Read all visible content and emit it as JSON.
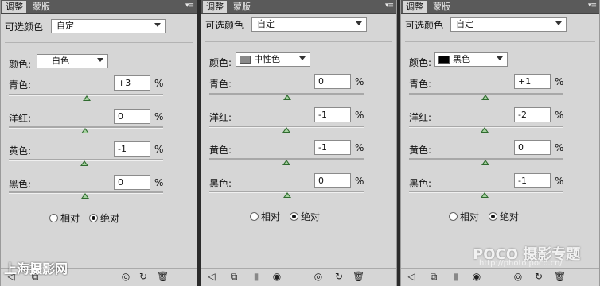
{
  "tabs": {
    "adjust": "调整",
    "mask": "蒙版"
  },
  "preset_label": "可选颜色",
  "preset_value": "自定",
  "colors_label": "颜色:",
  "slider_labels": {
    "cyan": "青色:",
    "magenta": "洋红:",
    "yellow": "黄色:",
    "black": "黑色:"
  },
  "percent_sign": "%",
  "radio": {
    "relative": "相对",
    "absolute": "绝对"
  },
  "panels": [
    {
      "color": "白色",
      "swatch": null,
      "values": [
        "+3",
        "0",
        "-1",
        "0"
      ]
    },
    {
      "color": "中性色",
      "swatch": "#8a8a8a",
      "values": [
        "0",
        "-1",
        "-1",
        "0"
      ]
    },
    {
      "color": "黑色",
      "swatch": "#000000",
      "values": [
        "+1",
        "-2",
        "0",
        "-1"
      ]
    }
  ],
  "watermarks": {
    "left": "上海摄影网",
    "right_brand": "POCO 摄影专题",
    "right_url": "http://photo.poco.cn/"
  }
}
